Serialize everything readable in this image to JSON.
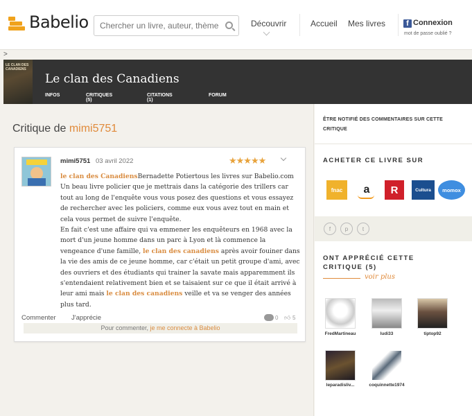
{
  "header": {
    "logo": "Babelio",
    "search_placeholder": "Chercher un livre, auteur, thème",
    "nav": {
      "decouvrir": "Découvrir",
      "accueil": "Accueil",
      "mes_livres": "Mes livres"
    },
    "fb_letter": "f",
    "connexion": "Connexion",
    "forgot_password": "mot de passe oublié ?"
  },
  "breadcrumb": ">",
  "book": {
    "cover_text": "LE CLAN DES CANADIENS",
    "title": "Le clan des Canadiens",
    "tabs": [
      "INFOS",
      "CRITIQUES (5)",
      "CITATIONS (1)",
      "FORUM"
    ]
  },
  "critique": {
    "heading_prefix": "Critique de",
    "heading_user": "mimi5751",
    "reviewer": "mimi5751",
    "date": "03 avril 2022",
    "stars": "★★★★★",
    "rating": 5,
    "body": {
      "link1": "le clan des Canadiens",
      "line1_rest": "Bernadette Potiertous les livres sur Babelio.com",
      "p1": "Un beau livre policier que je mettrais dans la catégorie des trillers car tout au long de l'enquête vous vous posez des questions et vous essayez de rechercher avec les policiers, comme eux vous avez tout en main et cela vous permet de suivre l'enquête.",
      "p2a": "En fait c'est une affaire qui va emmener les enquêteurs en 1968 avec la mort d'un jeune homme dans un parc à Lyon et là commence la vengeance d'une famille,",
      "link2": "le clan des canadiens",
      "p2b": "après avoir fouiner dans la vie des amis de ce jeune homme, car c'était un petit groupe d'ami, avec des ouvriers et des étudiants qui trainer la savate mais apparemment ils s'entendaient relativement bien et se taisaient sur ce que il était arrivé à leur ami mais",
      "link3": "le clan des canadiens",
      "p2c": "veille et va se venger des années plus tard."
    },
    "commenter": "Commenter",
    "japprecie": "J'apprécie",
    "comments_count": "0",
    "likes_count": "5",
    "login_prefix": "Pour commenter,",
    "login_link": "je me connecte à Babelio"
  },
  "sidebar": {
    "notify": "ÊTRE NOTIFIÉ DES COMMENTAIRES SUR CETTE CRITIQUE",
    "buy_title": "ACHETER CE LIVRE SUR",
    "shops": {
      "fnac": "fnac",
      "amazon": "a",
      "r": "R",
      "cultura": "Cultura",
      "momox": "momox"
    },
    "social": [
      "f",
      "p",
      "t"
    ],
    "liked_title": "ONT APPRÉCIÉ CETTE CRITIQUE (5)",
    "see_more": "voir plus",
    "fans": [
      "FredMartineau",
      "ludi33",
      "tiptop92",
      "leparadisliv...",
      "coquinnette1974"
    ]
  },
  "colors": {
    "accent": "#e08a3a",
    "banner": "#333333",
    "stars": "#e8a33c",
    "fb": "#3b5998"
  }
}
